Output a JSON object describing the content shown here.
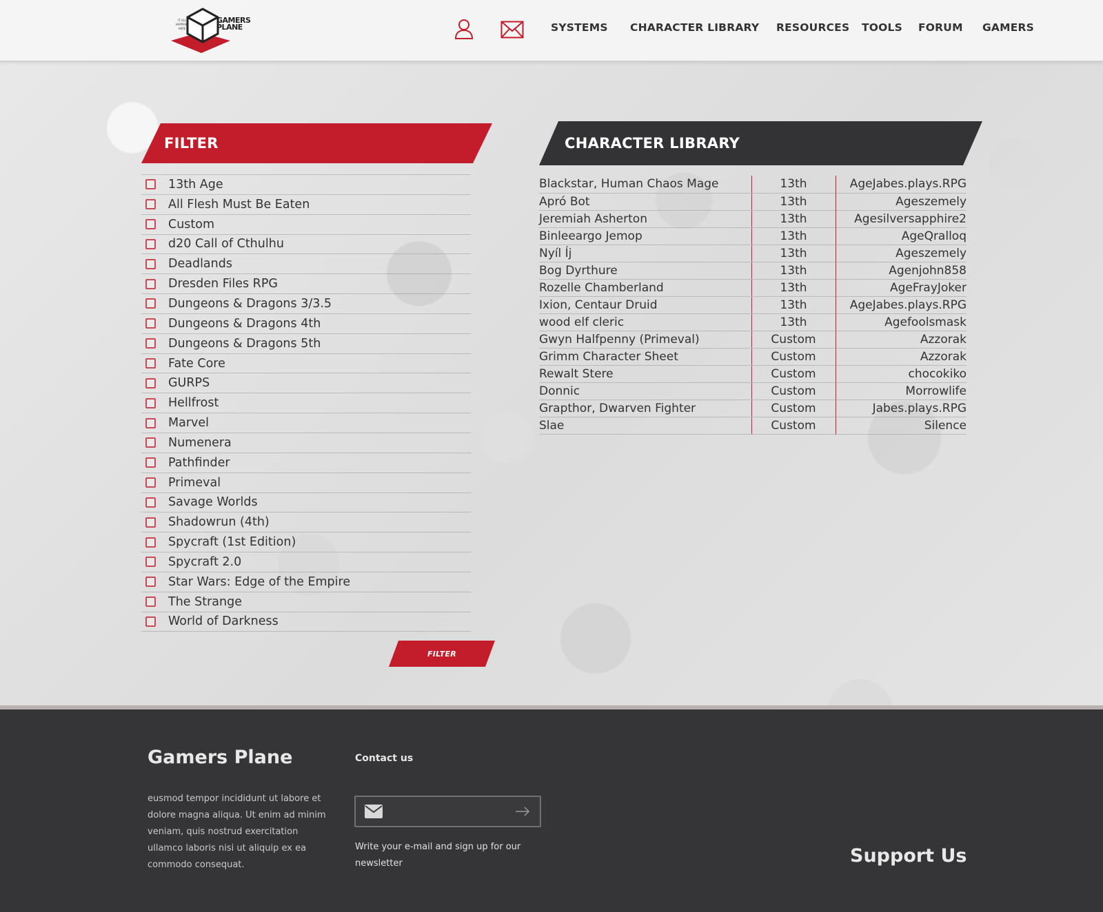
{
  "header": {
    "logo": {
      "name": "GAMERS PLANE",
      "tagline": "IT ALL HAPPENS HERE"
    },
    "icons": {
      "user": "user-icon",
      "mail": "mail-icon"
    },
    "nav": [
      "SYSTEMS",
      "CHARACTER LIBRARY",
      "RESOURCES",
      "TOOLS",
      "FORUM",
      "GAMERS"
    ]
  },
  "filter": {
    "title": "FILTER",
    "systems": [
      "13th Age",
      "All Flesh Must Be Eaten",
      "Custom",
      "d20 Call of Cthulhu",
      "Deadlands",
      "Dresden Files RPG",
      "Dungeons & Dragons 3/3.5",
      "Dungeons & Dragons 4th",
      "Dungeons & Dragons 5th",
      "Fate Core",
      "GURPS",
      "Hellfrost",
      "Marvel",
      "Numenera",
      "Pathfinder",
      "Primeval",
      "Savage Worlds",
      "Shadowrun (4th)",
      "Spycraft (1st Edition)",
      "Spycraft 2.0",
      "Star Wars: Edge of the Empire",
      "The Strange",
      "World of Darkness"
    ],
    "button_label": "FILTER"
  },
  "library": {
    "title": "CHARACTER LIBRARY",
    "rows": [
      {
        "name": "Blackstar, Human Chaos Mage",
        "system": "13th",
        "gamer": "AgeJabes.plays.RPG"
      },
      {
        "name": "Apró Bot",
        "system": "13th",
        "gamer": "Ageszemely"
      },
      {
        "name": "Jeremiah Asherton",
        "system": "13th",
        "gamer": "Agesilversapphire2"
      },
      {
        "name": "Binleeargo Jemop",
        "system": "13th",
        "gamer": "AgeQralloq"
      },
      {
        "name": "Nyíl Íj",
        "system": "13th",
        "gamer": "Ageszemely"
      },
      {
        "name": "Bog Dyrthure",
        "system": "13th",
        "gamer": "Agenjohn858"
      },
      {
        "name": "Rozelle Chamberland",
        "system": "13th",
        "gamer": "AgeFrayJoker"
      },
      {
        "name": "Ixion, Centaur Druid",
        "system": "13th",
        "gamer": "AgeJabes.plays.RPG"
      },
      {
        "name": "wood elf cleric",
        "system": "13th",
        "gamer": "Agefoolsmask"
      },
      {
        "name": "Gwyn Halfpenny (Primeval)",
        "system": "Custom",
        "gamer": "Azzorak"
      },
      {
        "name": "Grimm Character Sheet",
        "system": "Custom",
        "gamer": "Azzorak"
      },
      {
        "name": "Rewalt Stere",
        "system": "Custom",
        "gamer": "chocokiko"
      },
      {
        "name": "Donnic",
        "system": "Custom",
        "gamer": "Morrowlife"
      },
      {
        "name": "Grapthor, Dwarven Fighter",
        "system": "Custom",
        "gamer": "Jabes.plays.RPG"
      },
      {
        "name": "Slae",
        "system": "Custom",
        "gamer": "Silence"
      }
    ]
  },
  "footer": {
    "title": "Gamers Plane",
    "text": "eusmod tempor incididunt ut labore et dolore magna aliqua. Ut enim ad minim veniam, quis nostrud exercitation ullamco laboris nisi ut aliquip ex ea commodo consequat.",
    "contact_title": "Contact us",
    "newsletter_placeholder": "",
    "newsletter_text": "Write your e-mail and sign up for our newsletter",
    "support_title": "Support Us"
  },
  "colors": {
    "accent_red": "#c31c2a",
    "banner_dark": "#333336",
    "footer_bg": "#353537"
  }
}
